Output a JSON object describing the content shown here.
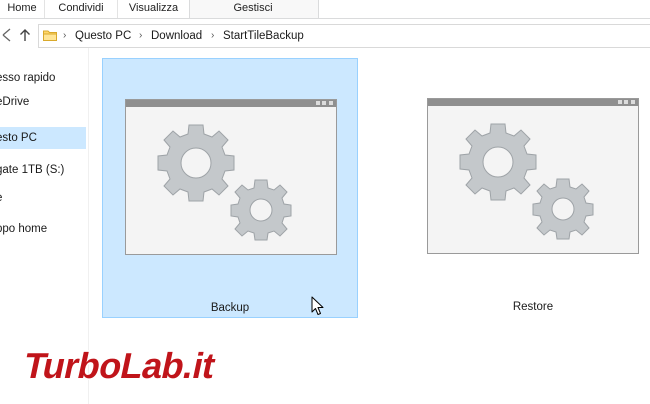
{
  "ribbon": {
    "tabs": [
      "Home",
      "Condividi",
      "Visualizza",
      "Gestisci"
    ]
  },
  "address": {
    "crumbs": [
      "Questo PC",
      "Download",
      "StartTileBackup"
    ]
  },
  "sidebar": {
    "items": [
      {
        "label": "esso rapido"
      },
      {
        "label": "eDrive"
      },
      {
        "label": "esto PC"
      },
      {
        "label": "gate 1TB (S:)"
      },
      {
        "label": "e"
      },
      {
        "label": "ppo home"
      }
    ],
    "selected_index": 2
  },
  "tiles": [
    {
      "label": "Backup",
      "selected": true
    },
    {
      "label": "Restore",
      "selected": false
    }
  ],
  "watermark": {
    "text": "TurboLab.it"
  },
  "colors": {
    "selection_bg": "#cce8ff",
    "selection_border": "#99d1ff",
    "gear_fill": "#c6cacd",
    "watermark_red": "#c0141a"
  },
  "icons": [
    "folder-icon",
    "back-arrow-icon",
    "up-arrow-icon",
    "chevron-right-icon",
    "gear-icon",
    "mouse-cursor-icon"
  ]
}
